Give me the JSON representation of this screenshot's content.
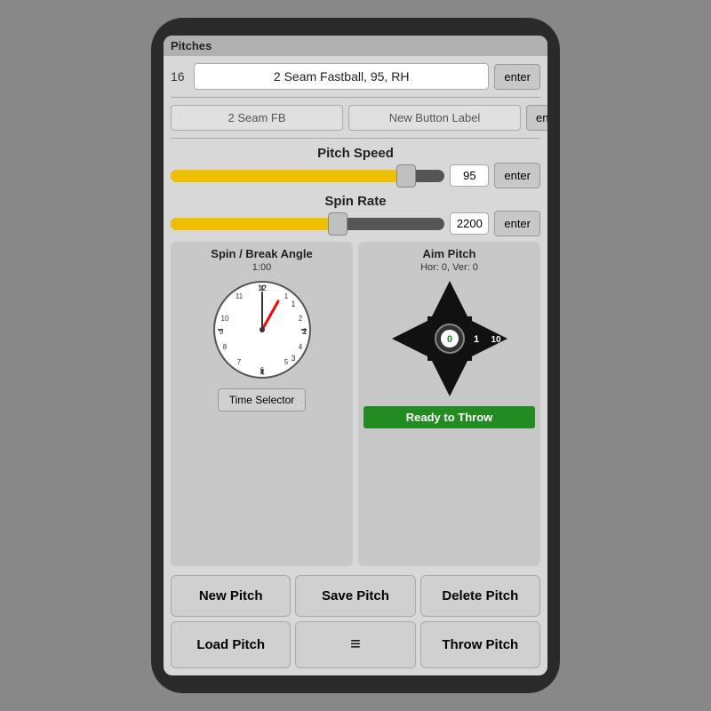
{
  "titleBar": {
    "label": "Pitches"
  },
  "mainInput": {
    "number": "16",
    "value": "2 Seam Fastball, 95, RH",
    "enterLabel": "enter"
  },
  "labelRow": {
    "shortName": "2 Seam FB",
    "newButtonLabel": "New Button Label",
    "enterLabel": "enter"
  },
  "pitchSpeed": {
    "label": "Pitch Speed",
    "value": 95,
    "min": 0,
    "max": 110,
    "fillPct": 86,
    "thumbPct": 86,
    "displayValue": "95",
    "enterLabel": "enter"
  },
  "spinRate": {
    "label": "Spin Rate",
    "value": 2200,
    "min": 0,
    "max": 3600,
    "fillPct": 61,
    "thumbPct": 61,
    "displayValue": "2200",
    "enterLabel": "enter"
  },
  "spinBreak": {
    "title": "Spin / Break Angle",
    "clockTime": "1:00",
    "timeSelectorLabel": "Time Selector"
  },
  "aimPitch": {
    "title": "Aim Pitch",
    "coords": "Hor: 0, Ver: 0",
    "centerValue": "0",
    "rightValue": "1",
    "farRightValue": "10",
    "readyLabel": "Ready to Throw"
  },
  "buttons": {
    "newPitch": "New Pitch",
    "savePitch": "Save Pitch",
    "deletePitch": "Delete Pitch",
    "loadPitch": "Load Pitch",
    "menuIcon": "≡",
    "throwPitch": "Throw Pitch"
  }
}
